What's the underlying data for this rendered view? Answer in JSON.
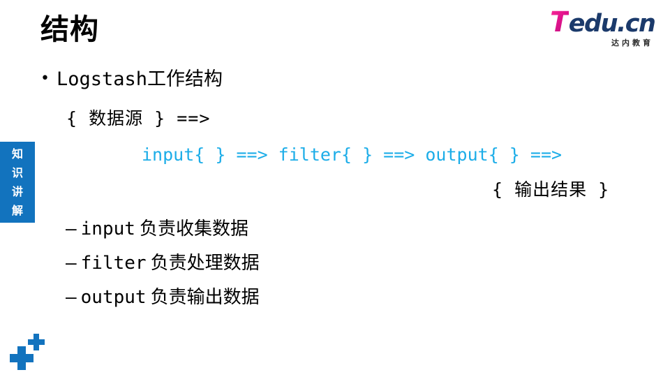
{
  "slide": {
    "title": "结构",
    "background_color": "#ffffff"
  },
  "logo": {
    "brand_first": "T",
    "brand_rest": "edu.cn",
    "subtitle": "达内教育",
    "brand_first_color": "#e0128c",
    "brand_rest_color": "#1b3a6b",
    "subtitle_color": "#2b2b2b"
  },
  "side_tab": {
    "background_color": "#1273be",
    "chars": [
      "知",
      "识",
      "讲",
      "解"
    ]
  },
  "content": {
    "bullet_marker": "•",
    "bullet_text": "Logstash工作结构",
    "source_line": "{ 数据源 } ==>",
    "pipeline_line": "input{ } ==> filter{ } ==> output{ } ==>",
    "pipeline_color": "#1cade8",
    "output_line": "{ 输出结果 }",
    "sub_items": [
      {
        "dash": "—",
        "keyword": "input",
        "desc": "负责收集数据"
      },
      {
        "dash": "—",
        "keyword": "filter",
        "desc": "负责处理数据"
      },
      {
        "dash": "—",
        "keyword": "output",
        "desc": "负责输出数据"
      }
    ]
  },
  "decoration": {
    "plus_color": "#1273be",
    "plus_large": "plus-icon-large",
    "plus_small": "plus-icon-small"
  }
}
